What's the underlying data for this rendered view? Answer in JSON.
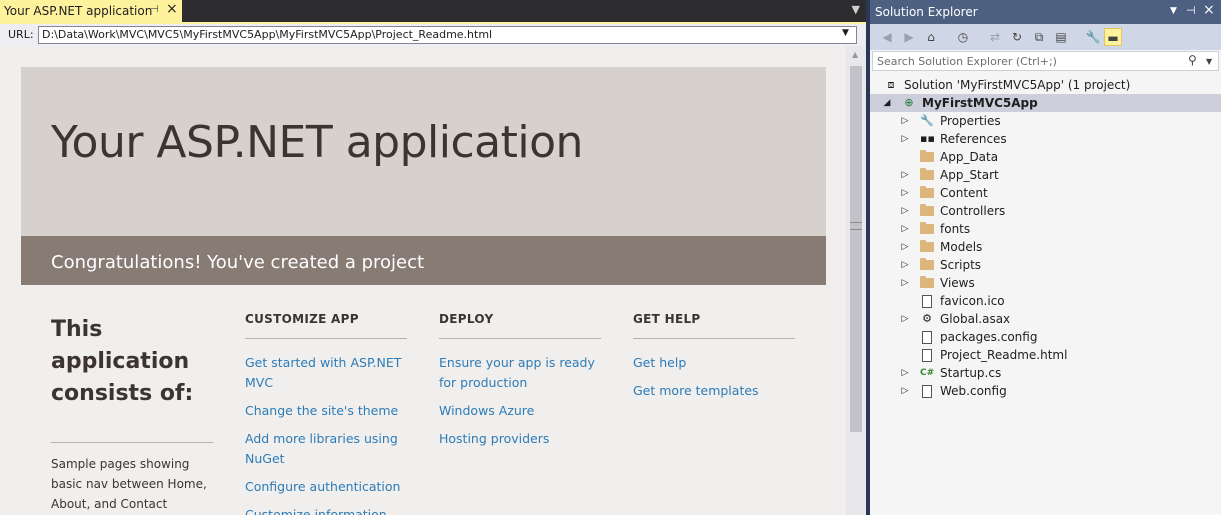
{
  "document": {
    "tab_title": "Your ASP.NET application",
    "pin_glyph": "⊣",
    "close_glyph": "×",
    "tabs_dropdown_glyph": "▼",
    "url_label": "URL:",
    "url_value": "D:\\Data\\Work\\MVC\\MVC5\\MyFirstMVC5App\\MyFirstMVC5App\\Project_Readme.html",
    "url_dropdown_glyph": "▼"
  },
  "page": {
    "jumbotron_title": "Your ASP.NET application",
    "banner_text": "Congratulations! You've created a project",
    "intro_title": "This application consists of:",
    "intro_text": "Sample pages showing basic nav between Home, About, and Contact",
    "columns": [
      {
        "heading": "CUSTOMIZE APP",
        "links": [
          "Get started with ASP.NET MVC",
          "Change the site's theme",
          "Add more libraries using NuGet",
          "Configure authentication",
          "Customize information"
        ]
      },
      {
        "heading": "DEPLOY",
        "links": [
          "Ensure your app is ready for production",
          "Windows Azure",
          "Hosting providers"
        ]
      },
      {
        "heading": "GET HELP",
        "links": [
          "Get help",
          "Get more templates"
        ]
      }
    ]
  },
  "solution_explorer": {
    "title": "Solution Explorer",
    "title_dropdown_glyph": "▼",
    "title_pin_glyph": "⊣",
    "title_close_glyph": "×",
    "search_placeholder": "Search Solution Explorer (Ctrl+;)",
    "search_icon_glyph": "⚲",
    "search_dropdown_glyph": "▼",
    "toolbar": [
      {
        "name": "back-icon",
        "glyph": "◀",
        "dim": true
      },
      {
        "name": "forward-icon",
        "glyph": "▶",
        "dim": true
      },
      {
        "name": "home-icon",
        "glyph": "⌂",
        "dim": false
      },
      {
        "name": "history-icon",
        "glyph": "◷",
        "dim": false
      },
      {
        "name": "sync-icon",
        "glyph": "⇄",
        "dim": true
      },
      {
        "name": "refresh-icon",
        "glyph": "↻",
        "dim": false
      },
      {
        "name": "collapse-all-icon",
        "glyph": "⧉",
        "dim": false
      },
      {
        "name": "show-all-files-icon",
        "glyph": "▤",
        "dim": false
      },
      {
        "name": "properties-icon",
        "glyph": "🔧",
        "dim": false
      },
      {
        "name": "preview-icon",
        "glyph": "▬",
        "dim": false
      }
    ],
    "tree": [
      {
        "label": "Solution 'MyFirstMVC5App' (1 project)",
        "indent": 0,
        "expander": "",
        "icon": "solution-icon",
        "glyph": "⧈",
        "bold": false,
        "selected": false
      },
      {
        "label": "MyFirstMVC5App",
        "indent": 1,
        "expander": "◢",
        "icon": "web-project-icon",
        "glyph": "⊕",
        "bold": true,
        "selected": true
      },
      {
        "label": "Properties",
        "indent": 2,
        "expander": "▷",
        "icon": "wrench-icon",
        "glyph": "🔧",
        "bold": false,
        "selected": false
      },
      {
        "label": "References",
        "indent": 2,
        "expander": "▷",
        "icon": "references-icon",
        "glyph": "▪▪",
        "bold": false,
        "selected": false
      },
      {
        "label": "App_Data",
        "indent": 2,
        "expander": "",
        "icon": "folder-icon",
        "glyph": "",
        "bold": false,
        "selected": false
      },
      {
        "label": "App_Start",
        "indent": 2,
        "expander": "▷",
        "icon": "folder-icon",
        "glyph": "",
        "bold": false,
        "selected": false
      },
      {
        "label": "Content",
        "indent": 2,
        "expander": "▷",
        "icon": "folder-icon",
        "glyph": "",
        "bold": false,
        "selected": false
      },
      {
        "label": "Controllers",
        "indent": 2,
        "expander": "▷",
        "icon": "folder-icon",
        "glyph": "",
        "bold": false,
        "selected": false
      },
      {
        "label": "fonts",
        "indent": 2,
        "expander": "▷",
        "icon": "folder-icon",
        "glyph": "",
        "bold": false,
        "selected": false
      },
      {
        "label": "Models",
        "indent": 2,
        "expander": "▷",
        "icon": "folder-icon",
        "glyph": "",
        "bold": false,
        "selected": false
      },
      {
        "label": "Scripts",
        "indent": 2,
        "expander": "▷",
        "icon": "folder-icon",
        "glyph": "",
        "bold": false,
        "selected": false
      },
      {
        "label": "Views",
        "indent": 2,
        "expander": "▷",
        "icon": "folder-icon",
        "glyph": "",
        "bold": false,
        "selected": false
      },
      {
        "label": "favicon.ico",
        "indent": 2,
        "expander": "",
        "icon": "image-file-icon",
        "glyph": "",
        "bold": false,
        "selected": false
      },
      {
        "label": "Global.asax",
        "indent": 2,
        "expander": "▷",
        "icon": "global-asax-icon",
        "glyph": "⚙",
        "bold": false,
        "selected": false
      },
      {
        "label": "packages.config",
        "indent": 2,
        "expander": "",
        "icon": "config-file-icon",
        "glyph": "",
        "bold": false,
        "selected": false
      },
      {
        "label": "Project_Readme.html",
        "indent": 2,
        "expander": "",
        "icon": "html-file-icon",
        "glyph": "",
        "bold": false,
        "selected": false
      },
      {
        "label": "Startup.cs",
        "indent": 2,
        "expander": "▷",
        "icon": "csharp-file-icon",
        "glyph": "C#",
        "bold": false,
        "selected": false
      },
      {
        "label": "Web.config",
        "indent": 2,
        "expander": "▷",
        "icon": "config-file-icon",
        "glyph": "",
        "bold": false,
        "selected": false
      }
    ]
  }
}
